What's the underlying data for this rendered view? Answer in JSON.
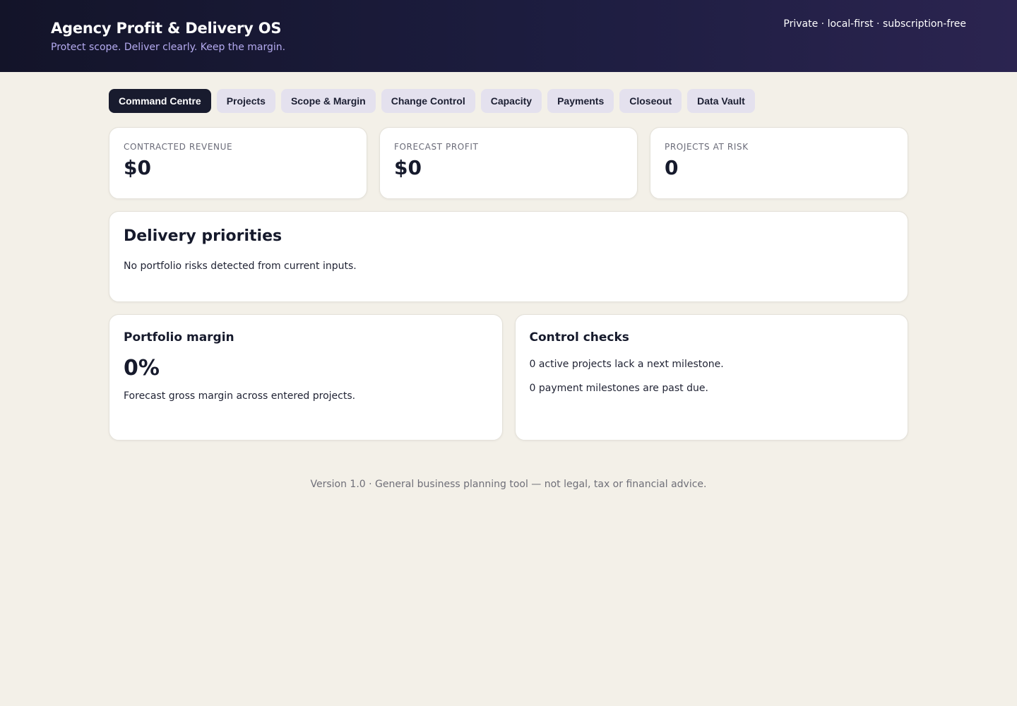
{
  "header": {
    "title": "Agency Profit & Delivery OS",
    "subtitle": "Protect scope. Deliver clearly. Keep the margin.",
    "tagline": "Private · local-first · subscription-free"
  },
  "tabs": [
    {
      "label": "Command Centre",
      "active": true
    },
    {
      "label": "Projects",
      "active": false
    },
    {
      "label": "Scope & Margin",
      "active": false
    },
    {
      "label": "Change Control",
      "active": false
    },
    {
      "label": "Capacity",
      "active": false
    },
    {
      "label": "Payments",
      "active": false
    },
    {
      "label": "Closeout",
      "active": false
    },
    {
      "label": "Data Vault",
      "active": false
    }
  ],
  "stats": [
    {
      "label": "Contracted revenue",
      "value": "$0"
    },
    {
      "label": "Forecast profit",
      "value": "$0"
    },
    {
      "label": "Projects at risk",
      "value": "0"
    }
  ],
  "priorities": {
    "title": "Delivery priorities",
    "message": "No portfolio risks detected from current inputs."
  },
  "portfolio_margin": {
    "title": "Portfolio margin",
    "value": "0%",
    "description": "Forecast gross margin across entered projects."
  },
  "control_checks": {
    "title": "Control checks",
    "items": [
      "0 active projects lack a next milestone.",
      "0 payment milestones are past due."
    ]
  },
  "footer": {
    "text": "Version 1.0 · General business planning tool — not legal, tax or financial advice."
  },
  "colors": {
    "header_bg_start": "#131429",
    "header_bg_end": "#2b2450",
    "subtitle": "#b5abf0",
    "page_bg": "#f3f0e8",
    "tab_active_bg": "#181b2e",
    "tab_bg": "#e4e1ee",
    "text_primary": "#161a2c"
  }
}
